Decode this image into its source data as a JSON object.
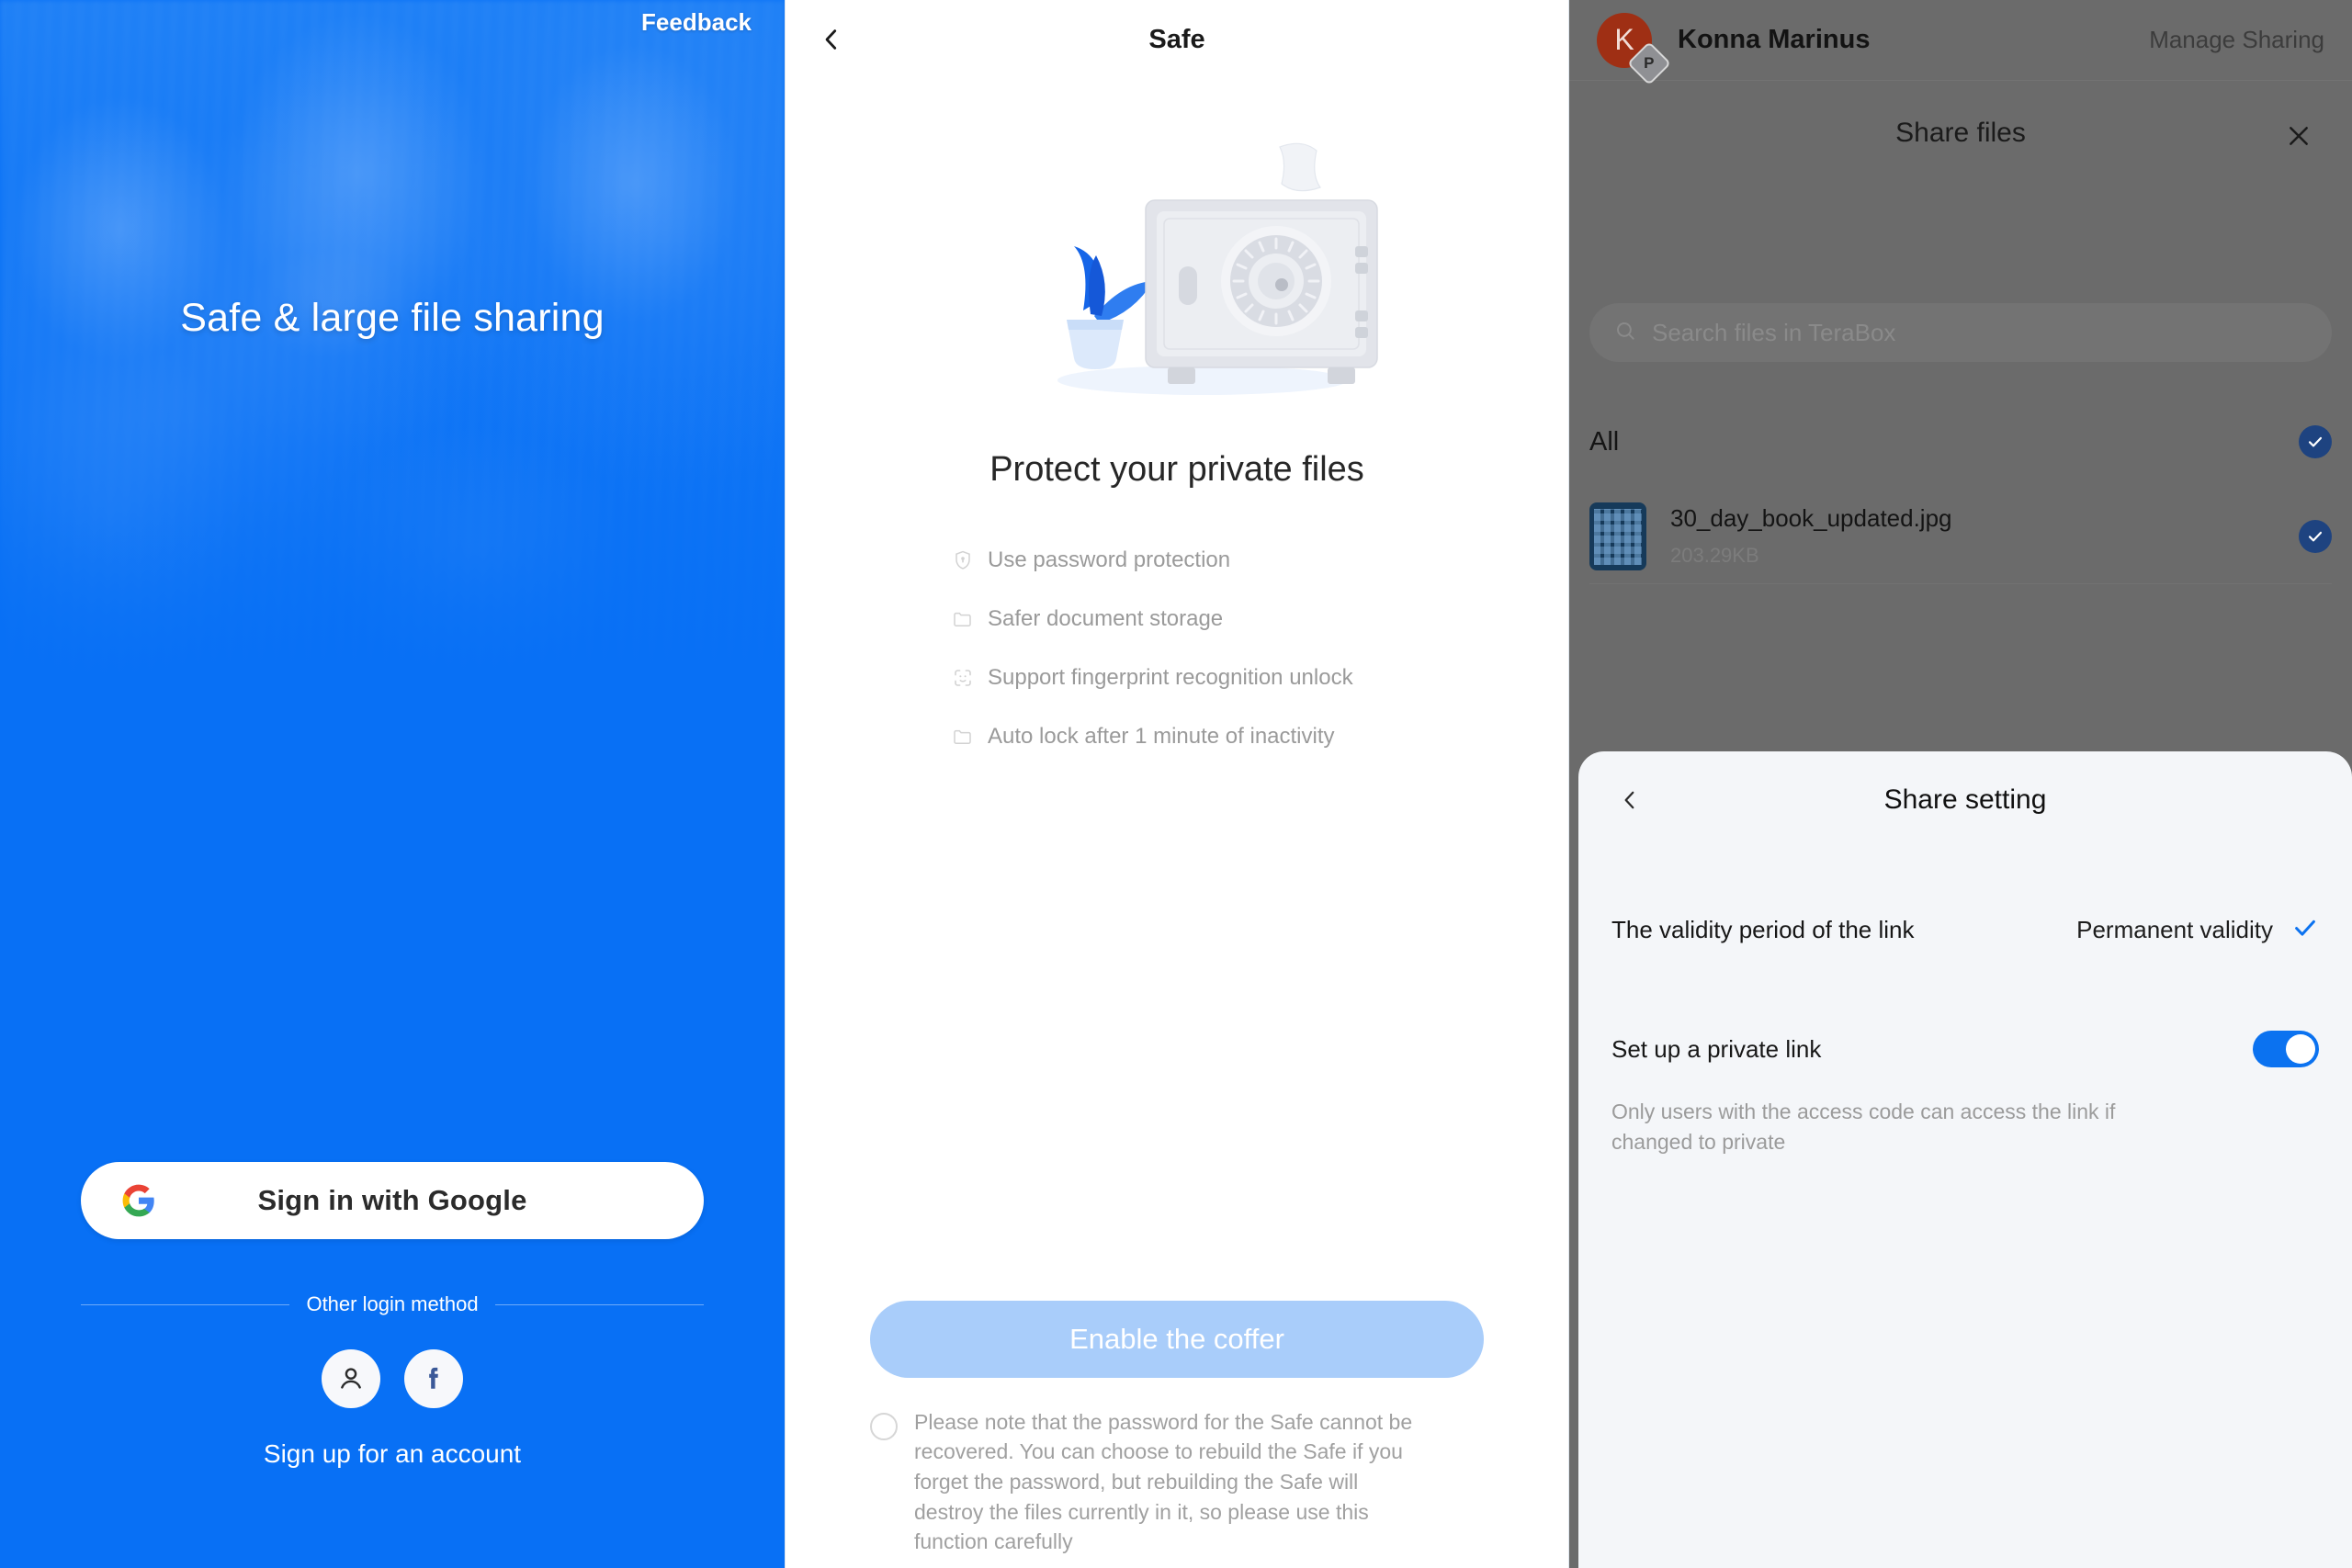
{
  "login": {
    "feedback_label": "Feedback",
    "hero_title": "Safe & large file sharing",
    "google_button_label": "Sign in with Google",
    "other_login_label": "Other login method",
    "signup_label": "Sign up for an account",
    "social_buttons": [
      {
        "icon": "person-icon",
        "name": "account-login"
      },
      {
        "icon": "facebook-icon",
        "name": "facebook-login"
      }
    ],
    "colors": {
      "brand_blue": "#0870f5",
      "button_bg": "#ffffff"
    }
  },
  "safe": {
    "back_icon": "chevron-left-icon",
    "title": "Safe",
    "illustration": "safe-vault-illustration",
    "caption": "Protect your private files",
    "features": [
      {
        "icon": "shield-lock-icon",
        "label": "Use password protection"
      },
      {
        "icon": "folder-icon",
        "label": "Safer document storage"
      },
      {
        "icon": "face-id-icon",
        "label": "Support fingerprint recognition unlock"
      },
      {
        "icon": "folder-icon",
        "label": "Auto lock after 1 minute of inactivity"
      }
    ],
    "enable_button_label": "Enable the coffer",
    "disclaimer": "Please note that the password for the Safe cannot be recovered. You can choose to rebuild the Safe if you forget the password, but rebuilding the Safe will destroy the files currently in it, so please use this function carefully",
    "disclaimer_checked": false,
    "colors": {
      "button_bg": "#a9cdfa",
      "button_text": "#ffffff"
    }
  },
  "share": {
    "account": {
      "avatar_initial": "K",
      "avatar_badge": "P",
      "name": "Konna Marinus",
      "manage_label": "Manage Sharing",
      "avatar_color": "#9f2f14"
    },
    "dialog": {
      "title": "Share files",
      "close_icon": "close-icon",
      "search_placeholder": "Search files in TeraBox",
      "search_icon": "search-icon",
      "all_label": "All",
      "all_selected": true,
      "files": [
        {
          "name": "30_day_book_updated.jpg",
          "size": "203.29KB",
          "selected": true,
          "thumb": "book-challenge-grid-thumbnail"
        }
      ]
    },
    "sheet": {
      "back_icon": "chevron-left-icon",
      "title": "Share setting",
      "validity_label": "The validity period of the link",
      "validity_value": "Permanent validity",
      "validity_check_icon": "check-icon",
      "private_link_label": "Set up a private link",
      "private_link_on": true,
      "private_link_help": "Only users with the access code can access the link if changed to private",
      "colors": {
        "toggle_on": "#0b72f0",
        "check": "#0b72f0",
        "sheet_bg": "#f4f6f9"
      }
    }
  }
}
